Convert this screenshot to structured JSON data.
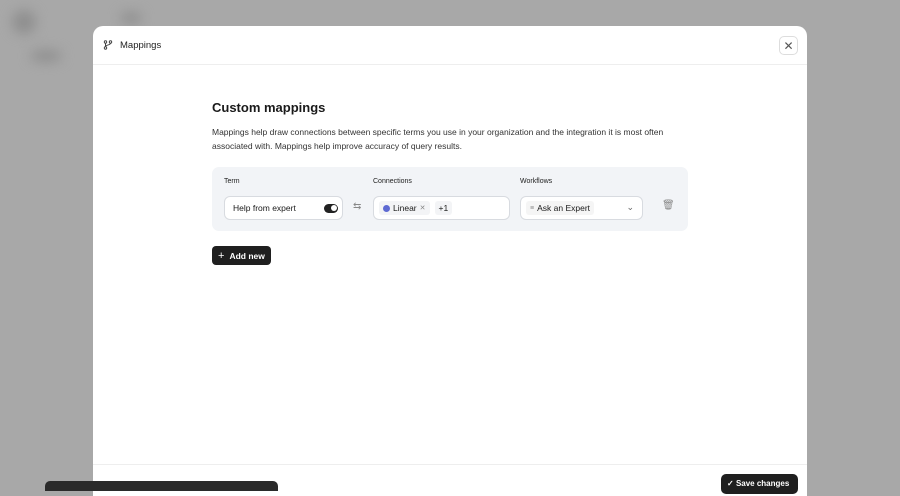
{
  "modal": {
    "title": "Mappings",
    "heading": "Custom mappings",
    "description": "Mappings help draw connections between specific terms you use in your organization and the integration it is most often associated with. Mappings help improve accuracy of query results."
  },
  "columns": {
    "term": "Term",
    "connections": "Connections",
    "workflows": "Workflows"
  },
  "row": {
    "term": "Help from expert",
    "term_toggle_on": true,
    "connection": "Linear",
    "connection_more": "+1",
    "workflow": "Ask an Expert"
  },
  "actions": {
    "add_new": "Add new",
    "save": "Save changes"
  },
  "colors": {
    "linear": "#5e6ad2",
    "button": "#1f1f1f"
  }
}
